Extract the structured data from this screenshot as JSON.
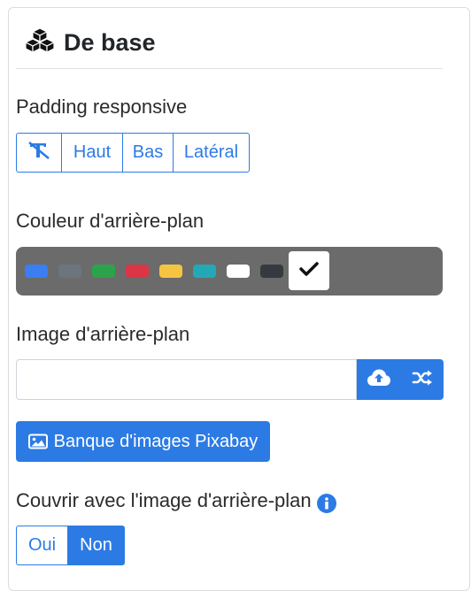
{
  "section": {
    "title": "De base",
    "icon": "cubes-icon"
  },
  "padding": {
    "label": "Padding responsive",
    "options": [
      "Haut",
      "Bas",
      "Latéral"
    ],
    "reset_icon": "text-clear-icon"
  },
  "background_color": {
    "label": "Couleur d'arrière-plan",
    "swatches": [
      "#3a7ef2",
      "#6c757d",
      "#2aa34a",
      "#dc3545",
      "#f5c542",
      "#23a9b5",
      "#ffffff",
      "#343a40"
    ],
    "selected_icon": "check-icon"
  },
  "background_image": {
    "label": "Image d'arrière-plan",
    "value": "",
    "placeholder": "",
    "upload_icon": "cloud-upload-icon",
    "random_icon": "shuffle-icon"
  },
  "pixabay": {
    "label": "Banque d'images Pixabay",
    "icon": "image-icon"
  },
  "cover": {
    "label": "Couvrir avec l'image d'arrière-plan",
    "info_icon": "info-icon",
    "options": [
      "Oui",
      "Non"
    ],
    "selected": "Non"
  },
  "colors": {
    "accent": "#2c7be5",
    "swatch_bar": "#6b6b6b"
  }
}
